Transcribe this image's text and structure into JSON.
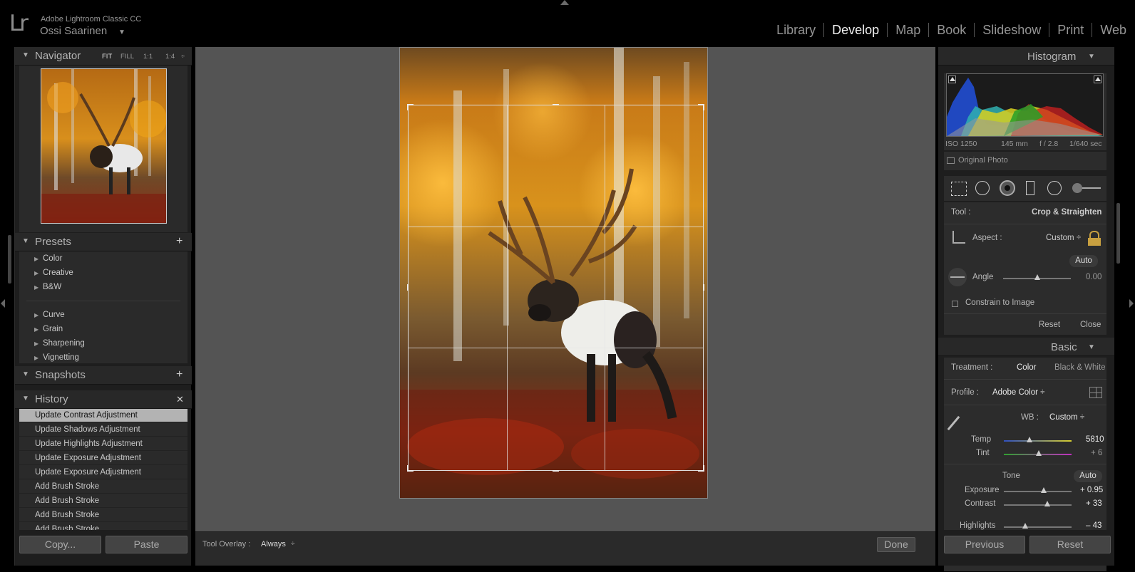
{
  "app": {
    "logo": "Lr",
    "product": "Adobe Lightroom Classic CC",
    "user": "Ossi Saarinen",
    "user_dropdown": "▼"
  },
  "modules": [
    "Library",
    "Develop",
    "Map",
    "Book",
    "Slideshow",
    "Print",
    "Web"
  ],
  "active_module": "Develop",
  "left": {
    "navigator": {
      "title": "Navigator",
      "options": [
        "FIT",
        "FILL",
        "1:1",
        "1:4"
      ]
    },
    "presets": {
      "title": "Presets",
      "add": "+",
      "items": [
        "Color",
        "Creative",
        "B&W",
        "Curve",
        "Grain",
        "Sharpening",
        "Vignetting"
      ]
    },
    "snapshots": {
      "title": "Snapshots",
      "add": "+"
    },
    "history": {
      "title": "History",
      "clear": "✕",
      "items": [
        "Update Contrast Adjustment",
        "Update Shadows Adjustment",
        "Update Highlights Adjustment",
        "Update Exposure Adjustment",
        "Update Exposure Adjustment",
        "Add Brush Stroke",
        "Add Brush Stroke",
        "Add Brush Stroke",
        "Add Brush Stroke"
      ],
      "selected_index": 0
    },
    "copy_label": "Copy...",
    "paste_label": "Paste"
  },
  "bottom": {
    "overlay_label": "Tool Overlay :",
    "overlay_value": "Always",
    "done_label": "Done"
  },
  "right": {
    "histogram": {
      "title": "Histogram",
      "iso": "ISO 1250",
      "focal": "145 mm",
      "aperture": "f / 2.8",
      "shutter": "1/640 sec",
      "original_photo": "Original Photo"
    },
    "crop": {
      "tool_label": "Tool :",
      "tool_value": "Crop & Straighten",
      "aspect_label": "Aspect :",
      "aspect_value": "Custom ÷",
      "auto_label": "Auto",
      "angle_label": "Angle",
      "angle_value": "0.00",
      "constrain_label": "Constrain to Image",
      "reset_label": "Reset",
      "close_label": "Close"
    },
    "basic": {
      "title": "Basic",
      "treatment_label": "Treatment :",
      "treatment_color": "Color",
      "treatment_bw": "Black & White",
      "profile_label": "Profile :",
      "profile_value": "Adobe Color ÷",
      "wb_label": "WB :",
      "wb_value": "Custom ÷",
      "temp_label": "Temp",
      "temp_value": "5810",
      "tint_label": "Tint",
      "tint_value": "+ 6",
      "tone_label": "Tone",
      "tone_auto": "Auto",
      "exposure_label": "Exposure",
      "exposure_value": "+ 0.95",
      "contrast_label": "Contrast",
      "contrast_value": "+ 33",
      "highlights_label": "Highlights",
      "highlights_value": "– 43"
    },
    "previous_label": "Previous",
    "reset_label": "Reset"
  },
  "colors": {
    "accent": "#f0f0f0",
    "panel": "#1e1e1e",
    "canvas": "#545454"
  }
}
